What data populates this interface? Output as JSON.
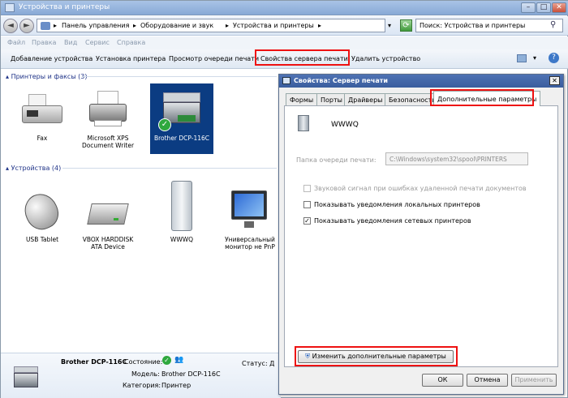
{
  "window": {
    "title": "Устройства и принтеры",
    "min": "–",
    "max": "□",
    "close": "✕"
  },
  "address": {
    "back": "◄",
    "forward": "►",
    "seg1": "Панель управления",
    "seg2": "Оборудование и звук",
    "seg3": "Устройства и принтеры",
    "sep": "▸",
    "refresh": "⟳",
    "search_placeholder": "Поиск: Устройства и принтеры"
  },
  "menu": [
    "Файл",
    "Правка",
    "Вид",
    "Сервис",
    "Справка"
  ],
  "toolbar": {
    "add_device": "Добавление устройства",
    "add_printer": "Установка принтера",
    "queue": "Просмотр очереди печати",
    "server_props": "Свойства сервера печати",
    "remove": "Удалить устройство"
  },
  "groups": {
    "printers": "Принтеры и факсы (3)",
    "devices": "Устройства (4)"
  },
  "printers": [
    {
      "label": "Fax"
    },
    {
      "label": "Microsoft XPS Document Writer"
    },
    {
      "label": "Brother DCP-116C"
    }
  ],
  "devices": [
    {
      "label": "USB Tablet"
    },
    {
      "label": "VBOX HARDDISK ATA Device"
    },
    {
      "label": "WWWQ"
    },
    {
      "label": "Универсальный монитор не PnP"
    }
  ],
  "details": {
    "name": "Brother DCP-116C",
    "state_label": "Состояние:",
    "model_label": "Модель:",
    "model_value": "Brother DCP-116C",
    "category_label": "Категория:",
    "category_value": "Принтер",
    "status_label": "Статус: Д"
  },
  "dialog": {
    "title": "Свойства: Сервер печати",
    "close": "✕",
    "tabs": [
      "Формы",
      "Порты",
      "Драйверы",
      "Безопасность",
      "Дополнительные параметры"
    ],
    "server_name": "WWWQ",
    "spool_label": "Папка очереди печати:",
    "spool_value": "C:\\Windows\\system32\\spool\\PRINTERS",
    "cb1": "Звуковой сигнал при ошибках удаленной печати документов",
    "cb2": "Показывать уведомления локальных принтеров",
    "cb3": "Показывать уведомления сетевых принтеров",
    "cb3_mark": "✓",
    "change_btn": "Изменить дополнительные параметры",
    "ok": "ОК",
    "cancel": "Отмена",
    "apply": "Применить"
  },
  "colors": {
    "highlight_red": "#e11111",
    "selected_tile": "#0b3c82",
    "title_blue": "#3a5d9e"
  }
}
